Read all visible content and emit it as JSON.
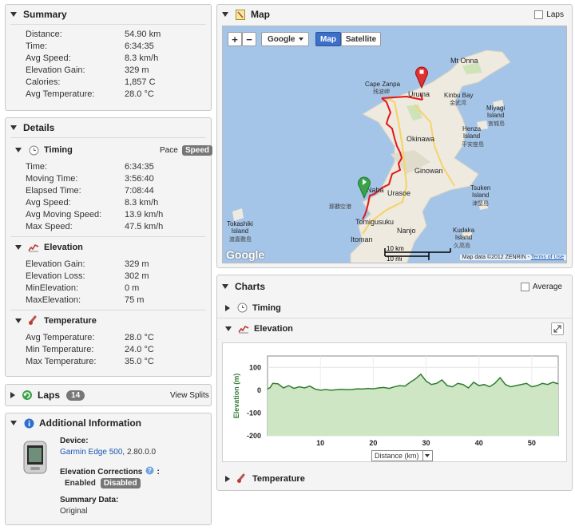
{
  "summary": {
    "title": "Summary",
    "rows": [
      {
        "label": "Distance:",
        "value": "54.90 km"
      },
      {
        "label": "Time:",
        "value": "6:34:35"
      },
      {
        "label": "Avg Speed:",
        "value": "8.3 km/h"
      },
      {
        "label": "Elevation Gain:",
        "value": "329 m"
      },
      {
        "label": "Calories:",
        "value": "1,857 C"
      },
      {
        "label": "Avg Temperature:",
        "value": "28.0 °C"
      }
    ]
  },
  "details": {
    "title": "Details",
    "timing": {
      "title": "Timing",
      "pace_label": "Pace",
      "speed_label": "Speed",
      "rows": [
        {
          "label": "Time:",
          "value": "6:34:35"
        },
        {
          "label": "Moving Time:",
          "value": "3:56:40"
        },
        {
          "label": "Elapsed Time:",
          "value": "7:08:44"
        },
        {
          "label": "Avg Speed:",
          "value": "8.3 km/h"
        },
        {
          "label": "Avg Moving Speed:",
          "value": "13.9 km/h"
        },
        {
          "label": "Max Speed:",
          "value": "47.5 km/h"
        }
      ]
    },
    "elevation": {
      "title": "Elevation",
      "rows": [
        {
          "label": "Elevation Gain:",
          "value": "329 m"
        },
        {
          "label": "Elevation Loss:",
          "value": "302 m"
        },
        {
          "label": "MinElevation:",
          "value": "0 m"
        },
        {
          "label": "MaxElevation:",
          "value": "75 m"
        }
      ]
    },
    "temperature": {
      "title": "Temperature",
      "rows": [
        {
          "label": "Avg Temperature:",
          "value": "28.0 °C"
        },
        {
          "label": "Min Temperature:",
          "value": "24.0 °C"
        },
        {
          "label": "Max Temperature:",
          "value": "35.0 °C"
        }
      ]
    }
  },
  "laps": {
    "title": "Laps",
    "count": "14",
    "view_splits": "View Splits"
  },
  "additional": {
    "title": "Additional Information",
    "device_label": "Device:",
    "device_link": "Garmin Edge 500",
    "device_version": ", 2.80.0.0",
    "corrections_label": "Elevation Corrections",
    "enabled": "Enabled",
    "disabled": "Disabled",
    "summary_label": "Summary Data:",
    "summary_value": "Original"
  },
  "map": {
    "title": "Map",
    "laps_label": "Laps",
    "zoom_in": "+",
    "zoom_out": "−",
    "provider": "Google",
    "map_btn": "Map",
    "satellite_btn": "Satellite",
    "scale_km": "10 km",
    "scale_mi": "10 mi",
    "attribution": "Map data ©2012 ZENRIN - ",
    "terms": "Terms of Use",
    "logo": "Google",
    "places": {
      "mt_onna": "Mt Onna",
      "cape_zanpa": "Cape Zanpa",
      "cape_zanpa_jp": "残波岬",
      "uruma": "Uruma",
      "kinbu_bay": "Kinbu Bay",
      "kinbu_bay_jp": "金武湾",
      "miyagi": "Miyagi\nIsland",
      "miyagi_jp": "宮城島",
      "henza": "Henza\nIsland",
      "henza_jp": "平安座島",
      "okinawa": "Okinawa",
      "ginowan": "Ginowan",
      "urasoe": "Urasoe",
      "naha": "Naha",
      "naha_airport_jp": "那覇空港",
      "tsuken": "Tsuken\nIsland",
      "tsuken_jp": "津堅島",
      "tokashiki": "Tokashiki\nIsland",
      "tokashiki_jp": "渡嘉敷島",
      "tomigusuku": "Tomigusuku",
      "nanjo": "Nanjo",
      "kudaka": "Kudaka\nIsland",
      "kudaka_jp": "久高島",
      "itoman": "Itoman"
    }
  },
  "charts": {
    "title": "Charts",
    "average_label": "Average",
    "timing": "Timing",
    "elevation": "Elevation",
    "temperature": "Temperature",
    "distance_select": "Distance (km)"
  },
  "chart_data": {
    "type": "area",
    "title": "",
    "xlabel": "Distance (km)",
    "ylabel": "Elevation (m)",
    "xlim": [
      0,
      55
    ],
    "ylim": [
      -200,
      150
    ],
    "xticks": [
      10,
      20,
      30,
      40,
      50
    ],
    "yticks": [
      100,
      0,
      -100,
      -200
    ],
    "series": [
      {
        "x": [
          0,
          0.5,
          1,
          2,
          3,
          4,
          5,
          6,
          7,
          8,
          9,
          10,
          11,
          12,
          13,
          14,
          15,
          16,
          17,
          18,
          19,
          20,
          21,
          22,
          23,
          24,
          25,
          26,
          27,
          28,
          29,
          30,
          31,
          32,
          33,
          34,
          35,
          36,
          37,
          38,
          39,
          40,
          41,
          42,
          43,
          44,
          45,
          46,
          47,
          48,
          49,
          50,
          51,
          52,
          53,
          54,
          55
        ],
        "values": [
          5,
          12,
          30,
          28,
          10,
          20,
          8,
          15,
          10,
          18,
          5,
          0,
          3,
          0,
          2,
          4,
          2,
          3,
          6,
          5,
          8,
          6,
          10,
          12,
          8,
          15,
          20,
          18,
          35,
          50,
          70,
          40,
          25,
          30,
          45,
          20,
          15,
          30,
          25,
          10,
          35,
          20,
          25,
          15,
          30,
          55,
          25,
          15,
          20,
          25,
          30,
          15,
          20,
          30,
          25,
          35,
          28
        ]
      }
    ],
    "colors": {
      "line": "#2e7d32",
      "fill": "#cfe6c4"
    },
    "grid": true
  }
}
